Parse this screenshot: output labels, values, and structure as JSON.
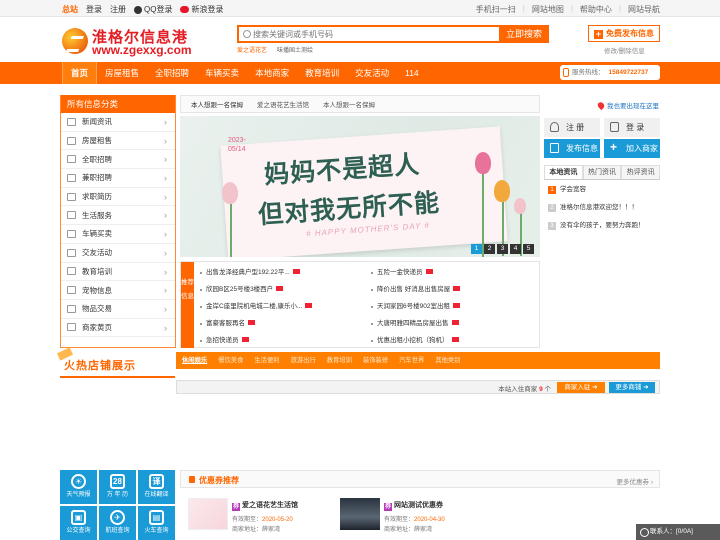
{
  "topbar": {
    "site": "总站",
    "login": "登录",
    "register": "注册",
    "qq_login": "QQ登录",
    "weibo_login": "新浪登录",
    "right_links": [
      "手机扫一扫",
      "网站地图",
      "帮助中心",
      "网站导航"
    ]
  },
  "logo": {
    "title": "淮格尔信息港",
    "domain": "www.zgexxg.com"
  },
  "search": {
    "placeholder": "搜索关键词或手机号码",
    "button": "立即搜索",
    "hot_keywords": [
      "爱之语花艺",
      "味播国土测绘"
    ]
  },
  "header": {
    "free_post": "免费发布信息",
    "edit_delete": "修改/删除信息"
  },
  "nav": {
    "items": [
      "首页",
      "房屋租售",
      "全职招聘",
      "车辆买卖",
      "本地商家",
      "教育培训",
      "交友活动",
      "114"
    ],
    "hotline_label": "服务热线：",
    "hotline_number": "15849722737"
  },
  "sidebar": {
    "title": "所有信息分类",
    "items": [
      "新闻资讯",
      "房屋租售",
      "全职招聘",
      "兼职招聘",
      "求职简历",
      "生活服务",
      "车辆买卖",
      "交友活动",
      "教育培训",
      "宠物信息",
      "物品交易",
      "商家黄页"
    ]
  },
  "center_tabs": [
    "本人想跟一名保姆",
    "爱之语花艺生活馆",
    "本人想跟一名保姆"
  ],
  "banner": {
    "date_line1": "2023-",
    "date_line2": "05/14",
    "line1": "妈妈不是超人",
    "line2": "但对我无所不能",
    "subline": "# HAPPY MOTHER'S DAY #",
    "pages": [
      "1",
      "2",
      "3",
      "4",
      "5"
    ]
  },
  "recommend": {
    "tag": "推荐信息",
    "left": [
      "出售龙泽经典户型192.22平...",
      "欣园B区25号楼3楼西户",
      "金岸C座里院机电城二楼,康乐小...",
      "富豪客服再名",
      "急招快递员"
    ],
    "right": [
      "五险一金快递员",
      "降价出售 好消息出售房屋",
      "天润家园6号楼902室出租",
      "大唐明雅四精品房屋出售",
      "优惠出租小挖机（狗机）"
    ]
  },
  "right_panel": {
    "my_info": "我也要出现在这里",
    "register": "注 册",
    "login": "登 录",
    "post": "发布信息",
    "join": "加入商家",
    "tabs": [
      "本地资讯",
      "热门资讯",
      "热评资讯"
    ],
    "news": [
      "学会宽容",
      "准格尔信息港欢迎您！！！",
      "没有伞的孩子，要努力奔跑！"
    ]
  },
  "hot_shops": {
    "title": "火热店铺展示",
    "categories": [
      "休闲娱乐",
      "餐饮美食",
      "生活便利",
      "旅游出行",
      "教育培训",
      "装饰装修",
      "汽车世界",
      "其他类别"
    ],
    "count_prefix": "本站入住商家",
    "count": "9",
    "count_suffix": "个",
    "join_btn": "商家入驻 ➜",
    "more_btn": "更多商铺 ➜"
  },
  "convenience": {
    "items": [
      {
        "label": "天气预报",
        "glyph": "☀"
      },
      {
        "label": "万 年 历",
        "glyph": "28"
      },
      {
        "label": "在线翻译",
        "glyph": "译"
      },
      {
        "label": "公交查询",
        "glyph": "▣"
      },
      {
        "label": "航班查询",
        "glyph": "✈"
      },
      {
        "label": "火车查询",
        "glyph": "▤"
      }
    ]
  },
  "coupons": {
    "title": "优惠券推荐",
    "more": "更多优惠券 ›",
    "valid_label": "有效期至：",
    "addr_label": "商家地址：",
    "items": [
      {
        "badge": "券",
        "name": "爱之语花艺生活馆",
        "valid": "2020-05-20",
        "addr": "薛家湾"
      },
      {
        "badge": "券",
        "name": "网站测试优惠券",
        "valid": "2020-04-30",
        "addr": "薛家湾"
      }
    ]
  },
  "contact": {
    "label": "联系人：[0/0A]"
  },
  "colors": {
    "brand": "#ff6600",
    "blue": "#1a9bd7"
  }
}
